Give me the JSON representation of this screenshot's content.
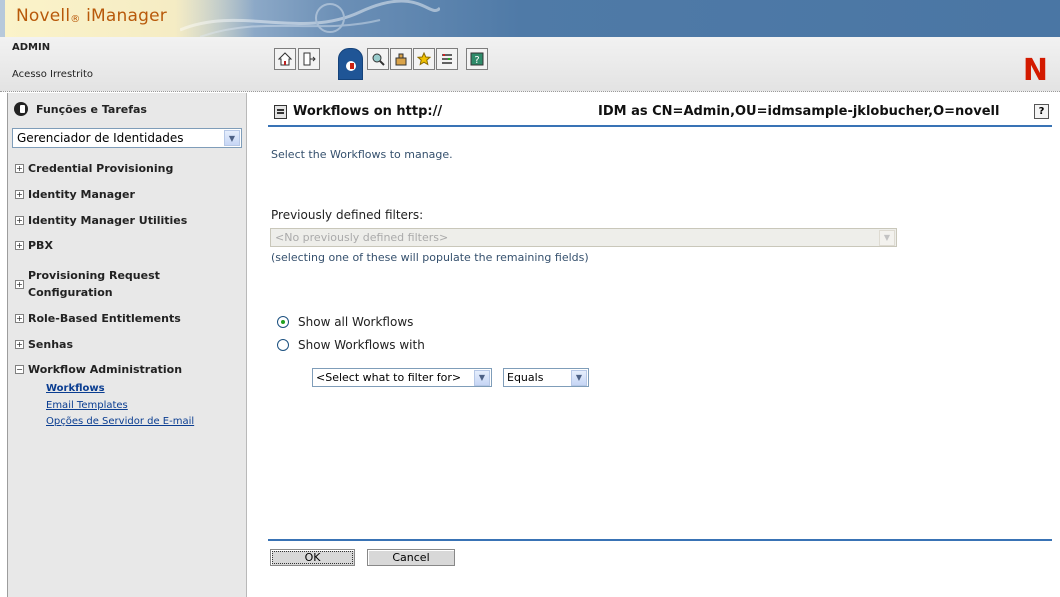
{
  "header": {
    "app_name": "Novell",
    "app_name_suffix": "iManager",
    "registered_mark": "®",
    "user": "ADMIN",
    "access": "Acesso Irrestrito",
    "brand_letter": "N",
    "brand_color": "#d31a00",
    "toolbar": [
      {
        "icon": "home-icon"
      },
      {
        "icon": "exit-icon"
      },
      {
        "icon": "roles-and-tasks-icon",
        "active": true
      },
      {
        "icon": "view-objects-icon"
      },
      {
        "icon": "configure-icon"
      },
      {
        "icon": "favorites-icon"
      },
      {
        "icon": "preferences-icon"
      },
      {
        "icon": "help-icon"
      }
    ]
  },
  "sidebar": {
    "title": "Funções e Tarefas",
    "role_select": {
      "value": "Gerenciador de Identidades"
    },
    "items": [
      {
        "label": "Credential Provisioning",
        "expander": "+"
      },
      {
        "label": "Identity Manager",
        "expander": "+"
      },
      {
        "label": "Identity Manager Utilities",
        "expander": "+"
      },
      {
        "label": "PBX",
        "expander": "+"
      },
      {
        "label": "Provisioning Request Configuration",
        "label_line1": "Provisioning Request",
        "label_line2": "Configuration",
        "expander": "+"
      },
      {
        "label": "Role-Based Entitlements",
        "expander": "+"
      },
      {
        "label": "Senhas",
        "expander": "+"
      },
      {
        "label": "Workflow Administration",
        "expander": "−"
      }
    ],
    "subitems": [
      {
        "label": "Workflows",
        "current": true
      },
      {
        "label": "Email Templates"
      },
      {
        "label": "Opções de Servidor de E-mail"
      }
    ]
  },
  "main": {
    "title": "Workflows on http://",
    "context": "IDM as CN=Admin,OU=idmsample-jklobucher,O=novell",
    "help": "?",
    "instructions": "Select the Workflows to manage.",
    "filters_label": "Previously defined filters:",
    "filters_placeholder": "<No previously defined filters>",
    "filters_hint": "(selecting one of these will populate the remaining fields)",
    "radio_all": "Show all Workflows",
    "radio_with": "Show Workflows with",
    "selected_radio": "all",
    "filter_field": "<Select what to filter for>",
    "filter_operator": "Equals",
    "ok_label": "OK",
    "cancel_label": "Cancel"
  },
  "colors": {
    "accent_rule": "#3973b5",
    "link": "#0a3d91",
    "logo_text": "#b8590a"
  }
}
